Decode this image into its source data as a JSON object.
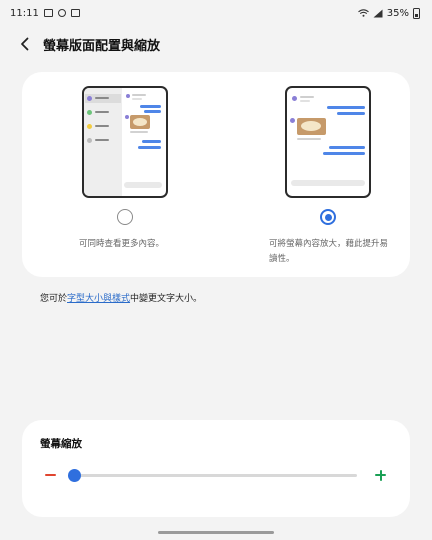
{
  "status_bar": {
    "time": "11:11",
    "battery_text": "35%",
    "left_icons": [
      "gallery-icon",
      "settings-icon",
      "photo-icon"
    ],
    "right_icons": [
      "wifi-icon",
      "signal-icon",
      "battery-icon"
    ]
  },
  "header": {
    "title": "螢幕版面配置與縮放"
  },
  "layout_options": [
    {
      "description": "可同時查看更多內容。",
      "selected": false
    },
    {
      "description": "可將螢幕內容放大，藉此提升易讀性。",
      "selected": true
    }
  ],
  "font_note": {
    "prefix": "您可於",
    "link": "字型大小與樣式",
    "suffix": "中變更文字大小。"
  },
  "zoom": {
    "title": "螢幕縮放",
    "level_fraction": 0.0
  },
  "colors": {
    "accent": "#2f6fde",
    "minus": "#e0452f",
    "plus": "#1aa055",
    "link": "#2a6bc9"
  }
}
